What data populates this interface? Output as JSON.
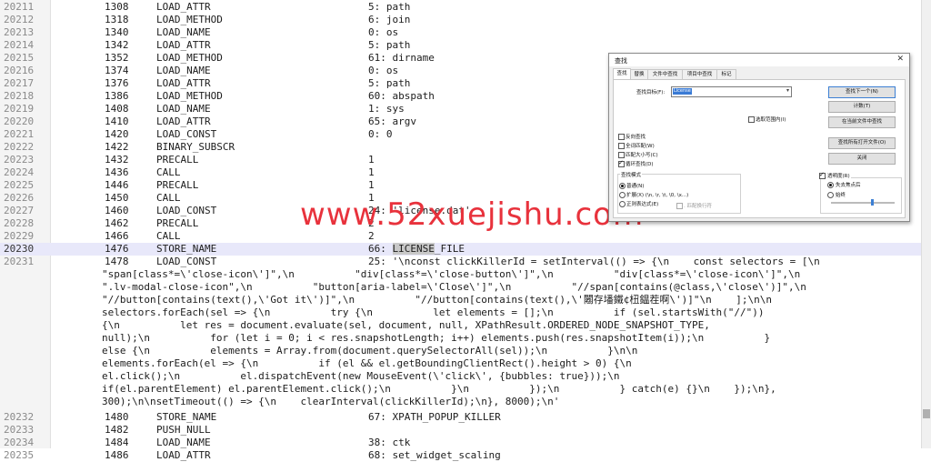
{
  "editor": {
    "lines": [
      {
        "ln": "20211",
        "offset": "1308",
        "op": "LOAD_ATTR",
        "arg": "5: path"
      },
      {
        "ln": "20212",
        "offset": "1318",
        "op": "LOAD_METHOD",
        "arg": "6: join"
      },
      {
        "ln": "20213",
        "offset": "1340",
        "op": "LOAD_NAME",
        "arg": "0: os"
      },
      {
        "ln": "20214",
        "offset": "1342",
        "op": "LOAD_ATTR",
        "arg": "5: path"
      },
      {
        "ln": "20215",
        "offset": "1352",
        "op": "LOAD_METHOD",
        "arg": "61: dirname"
      },
      {
        "ln": "20216",
        "offset": "1374",
        "op": "LOAD_NAME",
        "arg": "0: os"
      },
      {
        "ln": "20217",
        "offset": "1376",
        "op": "LOAD_ATTR",
        "arg": "5: path"
      },
      {
        "ln": "20218",
        "offset": "1386",
        "op": "LOAD_METHOD",
        "arg": "60: abspath"
      },
      {
        "ln": "20219",
        "offset": "1408",
        "op": "LOAD_NAME",
        "arg": "1: sys"
      },
      {
        "ln": "20220",
        "offset": "1410",
        "op": "LOAD_ATTR",
        "arg": "65: argv"
      },
      {
        "ln": "20221",
        "offset": "1420",
        "op": "LOAD_CONST",
        "arg": "0: 0"
      },
      {
        "ln": "20222",
        "offset": "1422",
        "op": "BINARY_SUBSCR",
        "arg": ""
      },
      {
        "ln": "20223",
        "offset": "1432",
        "op": "PRECALL",
        "arg": "1"
      },
      {
        "ln": "20224",
        "offset": "1436",
        "op": "CALL",
        "arg": "1"
      },
      {
        "ln": "20225",
        "offset": "1446",
        "op": "PRECALL",
        "arg": "1"
      },
      {
        "ln": "20226",
        "offset": "1450",
        "op": "CALL",
        "arg": "1"
      },
      {
        "ln": "20227",
        "offset": "1460",
        "op": "LOAD_CONST",
        "arg": "24: 'license.dat'"
      },
      {
        "ln": "20228",
        "offset": "1462",
        "op": "PRECALL",
        "arg": "2"
      },
      {
        "ln": "20229",
        "offset": "1466",
        "op": "CALL",
        "arg": "2"
      },
      {
        "ln": "20230",
        "offset": "1476",
        "op": "STORE_NAME",
        "arg_prefix": "66: ",
        "arg_sel": "LICENSE",
        "arg_suffix": "_FILE"
      },
      {
        "ln": "20231",
        "offset": "1478",
        "op": "LOAD_CONST",
        "arg": "25: '\\nconst clickKillerId = setInterval(() => {\\n    const selectors = [\\n"
      }
    ],
    "wrapped": [
      "\"span[class*=\\'close-icon\\']\",\\n          \"div[class*=\\'close-button\\']\",\\n          \"div[class*=\\'close-icon\\']\",\\n",
      "\".lv-modal-close-icon\",\\n          \"button[aria-label=\\'Close\\']\",\\n          \"//span[contains(@class,\\'close\\')]\",\\n",
      "\"//button[contains(text(),\\'Got it\\')]\",\\n          \"//button[contains(text(),\\'闂存墦鐵¢杻鎾茬啊\\')]\"\\n    ];\\n\\n",
      "selectors.forEach(sel => {\\n          try {\\n          let elements = [];\\n          if (sel.startsWith(\"//\"))",
      "{\\n          let res = document.evaluate(sel, document, null, XPathResult.ORDERED_NODE_SNAPSHOT_TYPE,",
      "null);\\n          for (let i = 0; i < res.snapshotLength; i++) elements.push(res.snapshotItem(i));\\n          }",
      "else {\\n          elements = Array.from(document.querySelectorAll(sel));\\n          }\\n\\n",
      "elements.forEach(el => {\\n          if (el && el.getBoundingClientRect().height > 0) {\\n",
      "el.click();\\n          el.dispatchEvent(new MouseEvent(\\'click\\', {bubbles: true}));\\n",
      "if(el.parentElement) el.parentElement.click();\\n          }\\n          });\\n          } catch(e) {}\\n    });\\n},",
      "300);\\n\\nsetTimeout(() => {\\n    clearInterval(clickKillerId);\\n}, 8000);\\n'"
    ],
    "after": [
      {
        "ln": "20232",
        "offset": "1480",
        "op": "STORE_NAME",
        "arg": "67: XPATH_POPUP_KILLER"
      },
      {
        "ln": "20233",
        "offset": "1482",
        "op": "PUSH_NULL",
        "arg": ""
      },
      {
        "ln": "20234",
        "offset": "1484",
        "op": "LOAD_NAME",
        "arg": "38: ctk"
      },
      {
        "ln": "20235",
        "offset": "1486",
        "op": "LOAD_ATTR",
        "arg": "68: set_widget_scaling"
      }
    ]
  },
  "watermark": "www.52xuejishu.com",
  "find_dialog": {
    "title": "查找",
    "close": "✕",
    "tabs": [
      "查找",
      "替换",
      "文件中查找",
      "项目中查找",
      "标记"
    ],
    "target_label": "查找目标(F):",
    "target_value": "License",
    "buttons": {
      "find_next": "查找下一个(N)",
      "count": "计数(T)",
      "find_in_current": "在当前文件中查找",
      "find_all_open": "查找所有打开文件(O)",
      "close": "关闭"
    },
    "in_selection": "选取范围内(I)",
    "options": [
      {
        "label": "反向查找",
        "checked": false
      },
      {
        "label": "全词匹配(W)",
        "checked": false
      },
      {
        "label": "匹配大小写(C)",
        "checked": false
      },
      {
        "label": "循环查找(D)",
        "checked": true
      }
    ],
    "mode_title": "查找模式",
    "modes": [
      {
        "label": "普通(N)",
        "checked": true
      },
      {
        "label": "扩展(X) (\\n, \\r, \\t, \\0, \\x...)",
        "checked": false
      },
      {
        "label": "正则表达式(E)",
        "checked": false
      }
    ],
    "dot_newline": ". 匹配换行符",
    "transparency_label": "透明度(R)",
    "transparency_checked": true,
    "transparency_options": [
      {
        "label": "失去焦点后",
        "checked": true
      },
      {
        "label": "始终",
        "checked": false
      }
    ],
    "transparency_level": 0.65
  }
}
